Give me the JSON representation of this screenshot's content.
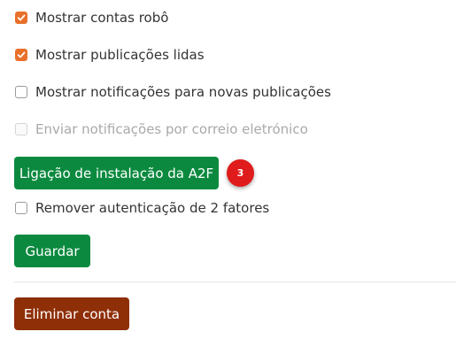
{
  "settings": {
    "show_bots": {
      "label": "Mostrar contas robô",
      "checked": true,
      "disabled": false
    },
    "show_read_posts": {
      "label": "Mostrar publicações lidas",
      "checked": true,
      "disabled": false
    },
    "new_post_notifications": {
      "label": "Mostrar notificações para novas publicações",
      "checked": false,
      "disabled": false
    },
    "email_notifications": {
      "label": "Enviar notificações por correio eletrónico",
      "checked": false,
      "disabled": true
    },
    "remove_2fa": {
      "label": "Remover autenticação de 2 fatores",
      "checked": false,
      "disabled": false
    }
  },
  "buttons": {
    "twofa_setup_label": "Ligação de instalação da A2F",
    "save_label": "Guardar",
    "delete_account_label": "Eliminar conta"
  },
  "badge": {
    "value": "3"
  },
  "colors": {
    "checkbox_checked": "#e8702a",
    "primary_button": "#0b8a3f",
    "danger_button": "#8e2f08",
    "badge": "#e01b1b"
  },
  "icons": {
    "checkmark": "checkmark-icon"
  }
}
